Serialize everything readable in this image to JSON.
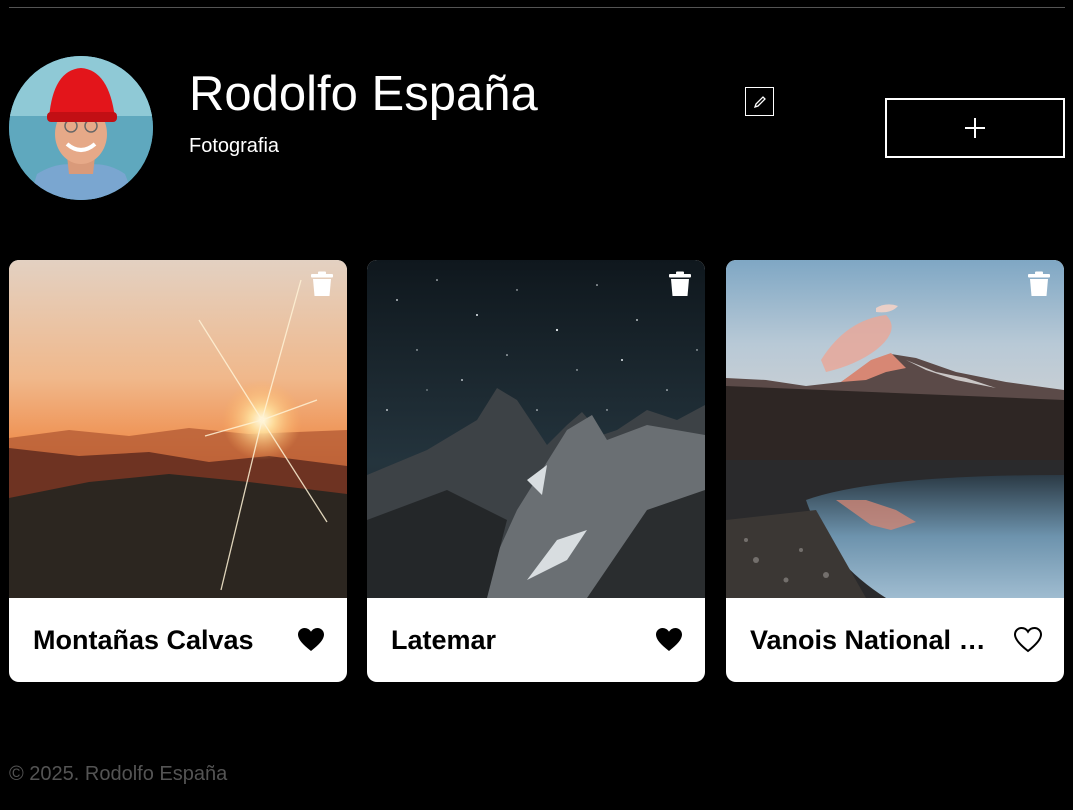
{
  "profile": {
    "name": "Rodolfo España",
    "about": "Fotografia",
    "add_label": "+"
  },
  "cards": [
    {
      "title": "Montañas Calvas",
      "liked": true,
      "delete_icon": "trash-icon",
      "like_icon": "heart-filled-icon"
    },
    {
      "title": "Latemar",
      "liked": true,
      "delete_icon": "trash-icon",
      "like_icon": "heart-filled-icon"
    },
    {
      "title": "Vanois National Park",
      "liked": false,
      "delete_icon": "trash-icon",
      "like_icon": "heart-outline-icon"
    }
  ],
  "footer": {
    "copyright": "© 2025. Rodolfo España"
  },
  "icons": {
    "edit": "pencil-icon",
    "add": "plus-icon"
  },
  "colors": {
    "background": "#000000",
    "card": "#ffffff",
    "footer_text": "#545454"
  }
}
